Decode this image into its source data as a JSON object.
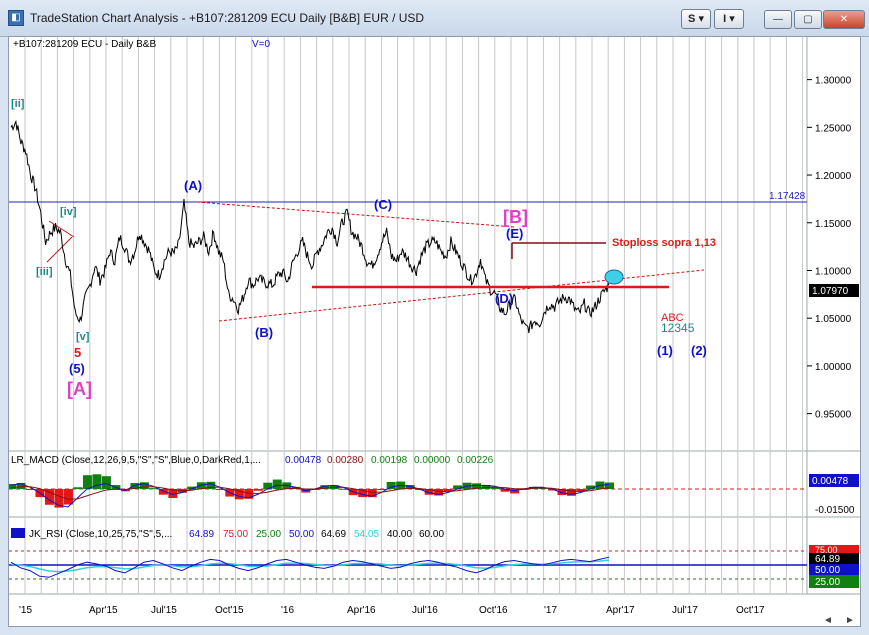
{
  "window": {
    "title": "TradeStation Chart Analysis - +B107:281209 ECU Daily [B&B] EUR / USD",
    "btn_s": "S",
    "btn_i": "I",
    "dropdown_glyph": "▾",
    "min_glyph": "—",
    "max_glyph": "▢",
    "close_glyph": "✕"
  },
  "price_panel": {
    "header": "+B107:281209 ECU - Daily  B&B",
    "v_label": "V=0",
    "hline_value": "1.17428",
    "last_price": "1.07970",
    "stoploss_text": "Stoploss sopra 1,13",
    "colors": {
      "wave_blue": "#1010c8",
      "wave_teal": "#1b8a8a",
      "wave_magenta": "#e040c8",
      "red": "#e01818"
    },
    "wave_labels": {
      "w_ii": "[ii]",
      "w_iv": "[iv]",
      "w_iii": "[iii]",
      "w_v": "[v]",
      "w_5red": "5",
      "w_5": "(5)",
      "w_A_big": "[A]",
      "w_A": "(A)",
      "w_B": "(B)",
      "w_C": "(C)",
      "w_D": "(D)",
      "w_E": "(E)",
      "w_B_big": "[B]",
      "w_abc": "ABC",
      "w_12345": "12345",
      "w_1": "(1)",
      "w_2": "(2)"
    }
  },
  "macd_panel": {
    "header": "LR_MACD (Close,12,26,9,5,\"S\",\"S\",Blue,0,DarkRed,1,...",
    "v1": "0.00478",
    "v2": "0.00280",
    "v3": "0.00198",
    "v4": "0.00000",
    "v5": "0.00226",
    "axis_value": "0.00478",
    "axis_neg": "-0.01500"
  },
  "rsi_panel": {
    "header": "JK_RSI (Close,10,25,75,\"S\",5,...",
    "v1": "64.89",
    "v2": "75.00",
    "v3": "25.00",
    "v4": "50.00",
    "v5": "64.69",
    "v6": "54.05",
    "v7": "40.00",
    "v8": "60.00",
    "axis_75": "75.00",
    "axis_cur": "64.89",
    "axis_50": "50.00",
    "axis_25": "25.00"
  },
  "chart_data": {
    "type": "line",
    "title": "+B107:281209 ECU - Daily  B&B",
    "x_ticks": [
      "'15",
      "Apr'15",
      "Jul'15",
      "Oct'15",
      "'16",
      "Apr'16",
      "Jul'16",
      "Oct'16",
      "'17",
      "Apr'17",
      "Jul'17",
      "Oct'17"
    ],
    "y_ticks": [
      "1.30000",
      "1.25000",
      "1.20000",
      "1.15000",
      "1.10000",
      "1.05000",
      "1.00000",
      "0.95000"
    ],
    "ylim": [
      0.915,
      1.33
    ],
    "series": [
      {
        "values": [
          {
            "t": 0,
            "v": 1.25
          },
          {
            "t": 1,
            "v": 1.256
          },
          {
            "t": 2,
            "v": 1.235
          },
          {
            "t": 3,
            "v": 1.225
          },
          {
            "t": 4,
            "v": 1.2
          },
          {
            "t": 5,
            "v": 1.185
          },
          {
            "t": 6,
            "v": 1.16
          },
          {
            "t": 7,
            "v": 1.13
          },
          {
            "t": 8,
            "v": 1.14
          },
          {
            "t": 9,
            "v": 1.145
          },
          {
            "t": 10,
            "v": 1.14
          },
          {
            "t": 11,
            "v": 1.112
          },
          {
            "t": 12,
            "v": 1.095
          },
          {
            "t": 13,
            "v": 1.055
          },
          {
            "t": 14,
            "v": 1.048
          },
          {
            "t": 15,
            "v": 1.07
          },
          {
            "t": 16,
            "v": 1.085
          },
          {
            "t": 17,
            "v": 1.105
          },
          {
            "t": 18,
            "v": 1.09
          },
          {
            "t": 19,
            "v": 1.1
          },
          {
            "t": 20,
            "v": 1.12
          },
          {
            "t": 21,
            "v": 1.11
          },
          {
            "t": 22,
            "v": 1.135
          },
          {
            "t": 23,
            "v": 1.125
          },
          {
            "t": 24,
            "v": 1.11
          },
          {
            "t": 25,
            "v": 1.12
          },
          {
            "t": 26,
            "v": 1.14
          },
          {
            "t": 27,
            "v": 1.13
          },
          {
            "t": 28,
            "v": 1.12
          },
          {
            "t": 29,
            "v": 1.1
          },
          {
            "t": 30,
            "v": 1.095
          },
          {
            "t": 31,
            "v": 1.11
          },
          {
            "t": 32,
            "v": 1.12
          },
          {
            "t": 33,
            "v": 1.118
          },
          {
            "t": 34,
            "v": 1.128
          },
          {
            "t": 35,
            "v": 1.17
          },
          {
            "t": 36,
            "v": 1.13
          },
          {
            "t": 37,
            "v": 1.125
          },
          {
            "t": 38,
            "v": 1.13
          },
          {
            "t": 39,
            "v": 1.135
          },
          {
            "t": 40,
            "v": 1.12
          },
          {
            "t": 41,
            "v": 1.14
          },
          {
            "t": 42,
            "v": 1.12
          },
          {
            "t": 43,
            "v": 1.11
          },
          {
            "t": 44,
            "v": 1.075
          },
          {
            "t": 45,
            "v": 1.07
          },
          {
            "t": 46,
            "v": 1.06
          },
          {
            "t": 47,
            "v": 1.072
          },
          {
            "t": 48,
            "v": 1.09
          },
          {
            "t": 49,
            "v": 1.085
          },
          {
            "t": 50,
            "v": 1.092
          },
          {
            "t": 51,
            "v": 1.088
          },
          {
            "t": 52,
            "v": 1.086
          },
          {
            "t": 53,
            "v": 1.085
          },
          {
            "t": 54,
            "v": 1.095
          },
          {
            "t": 55,
            "v": 1.098
          },
          {
            "t": 56,
            "v": 1.088
          },
          {
            "t": 57,
            "v": 1.108
          },
          {
            "t": 58,
            "v": 1.12
          },
          {
            "t": 59,
            "v": 1.13
          },
          {
            "t": 60,
            "v": 1.115
          },
          {
            "t": 61,
            "v": 1.105
          },
          {
            "t": 62,
            "v": 1.12
          },
          {
            "t": 63,
            "v": 1.128
          },
          {
            "t": 64,
            "v": 1.14
          },
          {
            "t": 65,
            "v": 1.145
          },
          {
            "t": 66,
            "v": 1.13
          },
          {
            "t": 67,
            "v": 1.15
          },
          {
            "t": 68,
            "v": 1.16
          },
          {
            "t": 69,
            "v": 1.14
          },
          {
            "t": 70,
            "v": 1.135
          },
          {
            "t": 71,
            "v": 1.125
          },
          {
            "t": 72,
            "v": 1.11
          },
          {
            "t": 73,
            "v": 1.105
          },
          {
            "t": 74,
            "v": 1.115
          },
          {
            "t": 75,
            "v": 1.13
          },
          {
            "t": 76,
            "v": 1.14
          },
          {
            "t": 77,
            "v": 1.115
          },
          {
            "t": 78,
            "v": 1.11
          },
          {
            "t": 79,
            "v": 1.12
          },
          {
            "t": 80,
            "v": 1.115
          },
          {
            "t": 81,
            "v": 1.105
          },
          {
            "t": 82,
            "v": 1.1
          },
          {
            "t": 83,
            "v": 1.115
          },
          {
            "t": 84,
            "v": 1.125
          },
          {
            "t": 85,
            "v": 1.13
          },
          {
            "t": 86,
            "v": 1.13
          },
          {
            "t": 87,
            "v": 1.12
          },
          {
            "t": 88,
            "v": 1.115
          },
          {
            "t": 89,
            "v": 1.13
          },
          {
            "t": 90,
            "v": 1.12
          },
          {
            "t": 91,
            "v": 1.11
          },
          {
            "t": 92,
            "v": 1.1
          },
          {
            "t": 93,
            "v": 1.09
          },
          {
            "t": 94,
            "v": 1.095
          },
          {
            "t": 95,
            "v": 1.112
          },
          {
            "t": 96,
            "v": 1.09
          },
          {
            "t": 97,
            "v": 1.08
          },
          {
            "t": 98,
            "v": 1.075
          },
          {
            "t": 99,
            "v": 1.06
          },
          {
            "t": 100,
            "v": 1.055
          },
          {
            "t": 101,
            "v": 1.065
          },
          {
            "t": 102,
            "v": 1.07
          },
          {
            "t": 103,
            "v": 1.05
          },
          {
            "t": 104,
            "v": 1.04
          },
          {
            "t": 105,
            "v": 1.04
          },
          {
            "t": 106,
            "v": 1.048
          },
          {
            "t": 107,
            "v": 1.045
          },
          {
            "t": 108,
            "v": 1.058
          },
          {
            "t": 109,
            "v": 1.065
          },
          {
            "t": 110,
            "v": 1.062
          },
          {
            "t": 111,
            "v": 1.068
          },
          {
            "t": 112,
            "v": 1.072
          },
          {
            "t": 113,
            "v": 1.07
          },
          {
            "t": 114,
            "v": 1.06
          },
          {
            "t": 115,
            "v": 1.055
          },
          {
            "t": 116,
            "v": 1.065
          },
          {
            "t": 117,
            "v": 1.055
          },
          {
            "t": 118,
            "v": 1.06
          },
          {
            "t": 119,
            "v": 1.07
          },
          {
            "t": 120,
            "v": 1.078
          },
          {
            "t": 121,
            "v": 1.085
          }
        ]
      }
    ],
    "macd": [
      0.004,
      0.006,
      0.002,
      -0.004,
      -0.012,
      -0.018,
      -0.02,
      -0.01,
      0.0,
      0.004,
      0.006,
      0.002,
      -0.002,
      0.004,
      0.006,
      0.003,
      -0.002,
      -0.006,
      -0.004,
      0.0,
      0.004,
      0.006,
      0.002,
      -0.004,
      -0.008,
      -0.01,
      -0.006,
      0.0,
      0.004,
      0.004,
      0.002,
      -0.002,
      0.0,
      0.003,
      0.004,
      0.002,
      -0.003,
      -0.006,
      -0.008,
      -0.004,
      0.002,
      0.004,
      0.003,
      0.0,
      -0.004,
      -0.006,
      -0.004,
      0.0,
      0.003,
      0.004,
      0.004,
      0.003,
      0.0,
      -0.002,
      0.0,
      0.002,
      0.002,
      0.0,
      -0.004,
      -0.006,
      -0.004,
      0.0,
      0.004,
      0.005
    ],
    "rsi": [
      55,
      45,
      40,
      30,
      28,
      35,
      42,
      50,
      55,
      52,
      48,
      40,
      36,
      45,
      55,
      58,
      52,
      45,
      40,
      48,
      55,
      60,
      58,
      50,
      44,
      40,
      45,
      52,
      58,
      60,
      55,
      50,
      46,
      44,
      48,
      55,
      58,
      56,
      52,
      48,
      44,
      46,
      52,
      56,
      58,
      55,
      50,
      46,
      40,
      36,
      42,
      50,
      56,
      58,
      55,
      52,
      50,
      54,
      58,
      60,
      58,
      56,
      60,
      64
    ]
  }
}
